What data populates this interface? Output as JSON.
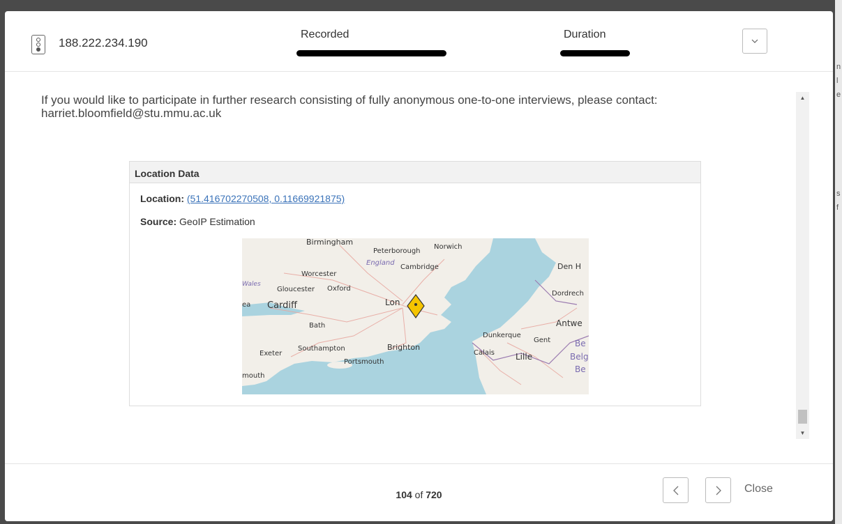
{
  "header": {
    "ip_address": "188.222.234.190",
    "recorded_label": "Recorded",
    "duration_label": "Duration",
    "dropdown_icon": "chevron-down-icon"
  },
  "content": {
    "intro_text": "If you would like to participate in further research consisting of fully anonymous one-to-one interviews, please contact: harriet.bloomfield@stu.mmu.ac.uk",
    "location_panel": {
      "title": "Location Data",
      "location_label": "Location:",
      "location_value": "(51.416702270508, 0.11669921875)",
      "source_label": "Source:",
      "source_value": "GeoIP Estimation"
    },
    "map_labels": {
      "birmingham": "Birmingham",
      "peterborough": "Peterborough",
      "norwich": "Norwich",
      "england": "England",
      "cambridge": "Cambridge",
      "worcester": "Worcester",
      "den_h": "Den H",
      "wales": "Wales",
      "gloucester": "Gloucester",
      "oxford": "Oxford",
      "dordrech": "Dordrech",
      "cardiff": "Cardiff",
      "lon": "Lon",
      "ea": "ea",
      "antwe": "Antwe",
      "bath": "Bath",
      "dunkerque": "Dunkerque",
      "gent": "Gent",
      "be1": "Be",
      "exeter": "Exeter",
      "southampton": "Southampton",
      "brighton": "Brighton",
      "calais": "Calais",
      "lille": "Lille",
      "belg": "Belg",
      "portsmouth": "Portsmouth",
      "be2": "Be",
      "mouth": "mouth"
    }
  },
  "footer": {
    "current_page": "104",
    "of_label": "of",
    "total_pages": "720",
    "close_label": "Close"
  },
  "colors": {
    "link": "#3b73b9",
    "marker": "#f5c400",
    "sea": "#aad3df",
    "land": "#f2efe9"
  }
}
